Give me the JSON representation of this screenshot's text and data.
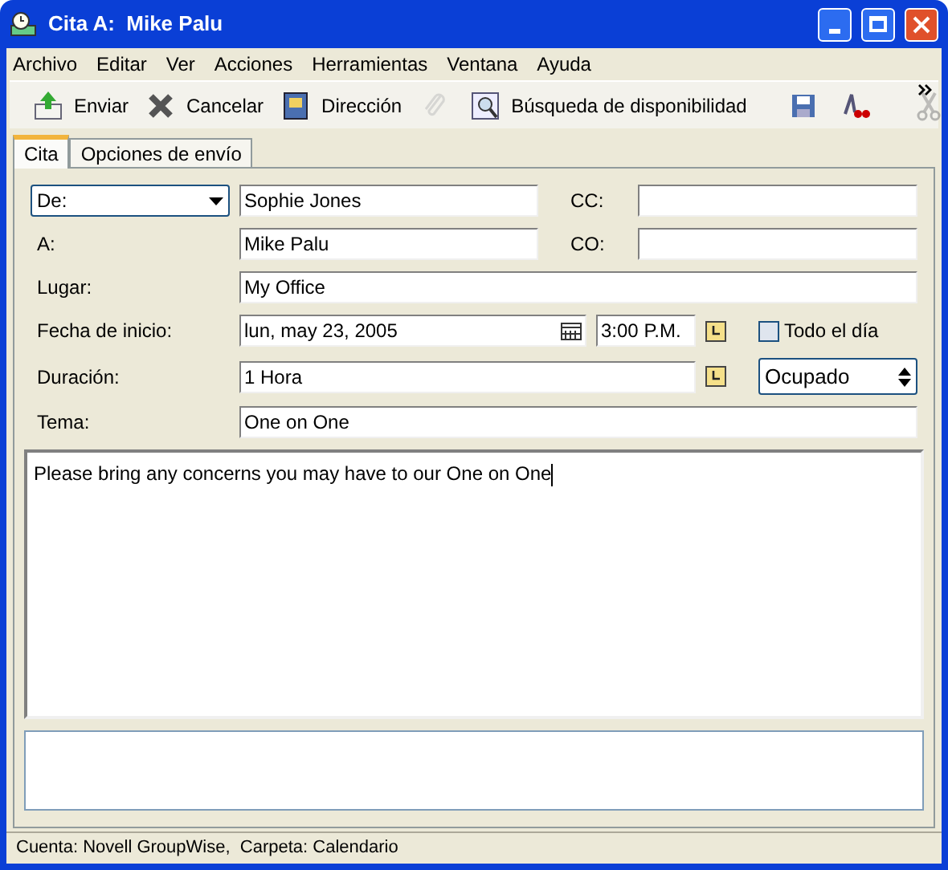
{
  "window": {
    "title": "Cita A:  Mike Palu"
  },
  "menu": [
    "Archivo",
    "Editar",
    "Ver",
    "Acciones",
    "Herramientas",
    "Ventana",
    "Ayuda"
  ],
  "toolbar": [
    {
      "kind": "labeled",
      "label": "Enviar",
      "disabled": false
    },
    {
      "kind": "labeled",
      "label": "Cancelar",
      "disabled": false
    },
    {
      "kind": "labeled",
      "label": "Dirección",
      "disabled": false
    },
    {
      "kind": "icon",
      "disabled": true
    },
    {
      "kind": "labeled",
      "label": "Búsqueda de disponibilidad",
      "disabled": false
    },
    {
      "kind": "separator"
    },
    {
      "kind": "icon",
      "disabled": false
    },
    {
      "kind": "icon",
      "disabled": false
    },
    {
      "kind": "separator"
    },
    {
      "kind": "icon",
      "disabled": true
    }
  ],
  "tabs": [
    {
      "label": "Cita",
      "selected": true
    },
    {
      "label": "Opciones de envío",
      "selected": false
    }
  ],
  "form": {
    "from_dropdown": "De:",
    "from": "Sophie Jones",
    "cc_label": "CC:",
    "to_label": "A:",
    "to": "Mike Palu",
    "bc_label": "CO:",
    "place_label": "Lugar:",
    "place": "My Office",
    "start_label": "Fecha de inicio:",
    "start_date": "lun, may 23, 2005",
    "start_time": "3:00 P.M.",
    "all_day_label": "Todo el día",
    "all_day": false,
    "duration_label": "Duración:",
    "duration": "1 Hora",
    "show_as": "Ocupado",
    "subject_label": "Tema:",
    "subject": "One on One"
  },
  "message": "Please bring any concerns you may have to our One on One",
  "status_bar": "Cuenta: Novell GroupWise,  Carpeta: Calendario"
}
